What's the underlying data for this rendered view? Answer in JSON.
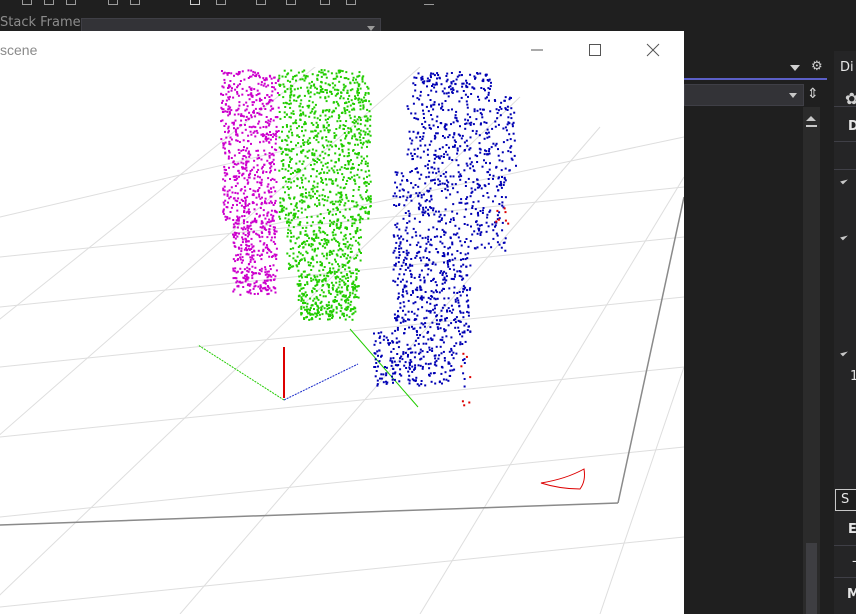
{
  "ide": {
    "stack_frame_label": "Stack Frame:",
    "stack_frame_value": "",
    "minimize_glyph": "_"
  },
  "scene": {
    "title": "scene",
    "controls": {
      "minimize": "minimize",
      "maximize": "maximize",
      "close": "close"
    }
  },
  "right_panel": {
    "tab_label": "Di",
    "items": [
      {
        "label": "D"
      },
      {
        "label": "1"
      },
      {
        "label": "S"
      },
      {
        "label": "E"
      },
      {
        "label": "M"
      }
    ]
  },
  "colors": {
    "magenta_points": "#cc00cc",
    "green_points": "#22cc00",
    "blue_points": "#0000b4",
    "red_points": "#dd0000",
    "grid": "#dedede",
    "axis_x": "#dd0000",
    "axis_y": "#22cc00",
    "axis_z": "#2233cc"
  },
  "icons": [
    "minimize-icon",
    "maximize-icon",
    "close-icon",
    "gear-icon",
    "split-icon",
    "chevron-down-icon"
  ]
}
